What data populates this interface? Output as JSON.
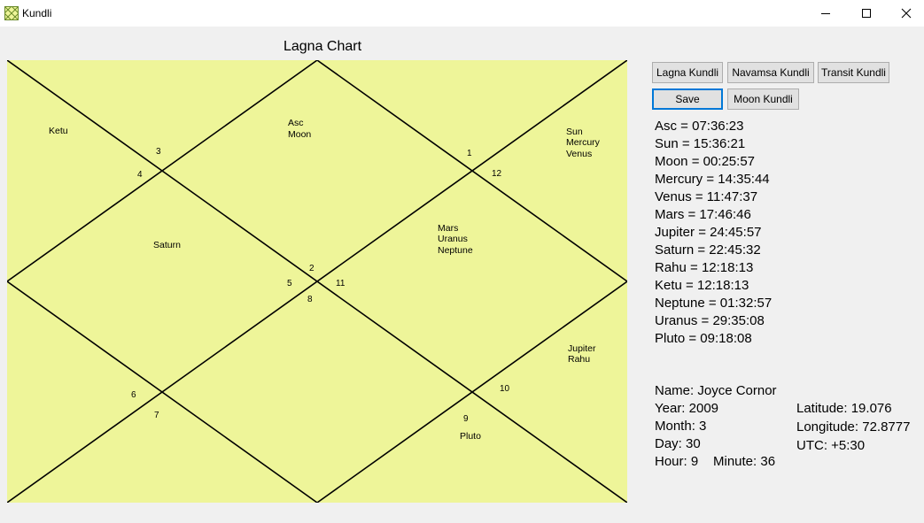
{
  "window": {
    "title": "Kundli"
  },
  "chart": {
    "title": "Lagna Chart",
    "background": "#eef599",
    "line_color": "#000000",
    "house_numbers": [
      "1",
      "2",
      "3",
      "4",
      "5",
      "6",
      "7",
      "8",
      "9",
      "10",
      "11",
      "12"
    ],
    "planet_blocks": [
      [
        "Asc",
        "Moon"
      ],
      [
        "Sun",
        "Mercury",
        "Venus"
      ],
      [
        "Ketu"
      ],
      [
        "Saturn"
      ],
      [
        "Mars",
        "Uranus",
        "Neptune"
      ],
      [
        "Jupiter",
        "Rahu"
      ],
      [
        "Pluto"
      ]
    ]
  },
  "buttons": {
    "lagna": "Lagna Kundli",
    "navamsa": "Navamsa Kundli",
    "transit": "Transit Kundli",
    "save": "Save",
    "moon": "Moon Kundli"
  },
  "positions": [
    "Asc = 07:36:23",
    "Sun = 15:36:21",
    "Moon = 00:25:57",
    "Mercury = 14:35:44",
    "Venus = 11:47:37",
    "Mars = 17:46:46",
    "Jupiter = 24:45:57",
    "Saturn = 22:45:32",
    "Rahu = 12:18:13",
    "Ketu = 12:18:13",
    "Neptune = 01:32:57",
    "Uranus = 29:35:08",
    "Pluto = 09:18:08"
  ],
  "details": {
    "name": "Name: Joyce Cornor",
    "year": "Year: 2009",
    "month": "Month: 3",
    "day": "Day: 30",
    "hour": "Hour: 9",
    "minute": "Minute: 36",
    "latitude": "Latitude: 19.076",
    "longitude": "Longitude: 72.8777",
    "utc": "UTC: +5:30"
  }
}
